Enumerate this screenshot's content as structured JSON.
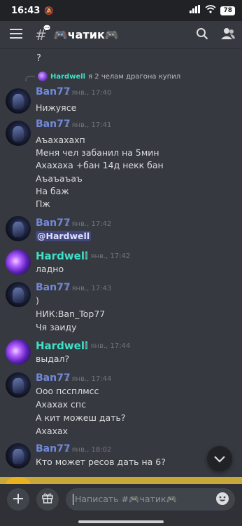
{
  "status_bar": {
    "time": "16:43",
    "battery": "78"
  },
  "header": {
    "channel_title": "🎮чатик🎮"
  },
  "chat": {
    "first_line": "?",
    "reply_preview": {
      "name": "Hardwell",
      "text": "я 2 челам драгона купил"
    },
    "messages": [
      {
        "author": "Ban77",
        "timestamp": "1 янв., 17:40",
        "lines": [
          "Нижуясе"
        ]
      },
      {
        "author": "Ban77",
        "timestamp": "1 янв., 17:41",
        "lines": [
          "Аъахахахп",
          "Меня чел забанил на 5мин",
          "Ахахаха +бан 14д некк бан",
          "Аъаъаъаъ",
          "На баж",
          "Пж"
        ]
      },
      {
        "author": "Ban77",
        "timestamp": "1 янв., 17:42",
        "lines": [
          "@Hardwell"
        ]
      },
      {
        "author": "Hardwell",
        "timestamp": "1 янв., 17:42",
        "lines": [
          "ладно"
        ]
      },
      {
        "author": "Ban77",
        "timestamp": "1 янв., 17:43",
        "lines": [
          ")",
          "НИК:Ban_Top77",
          "Чя заиду"
        ]
      },
      {
        "author": "Hardwell",
        "timestamp": "1 янв., 17:44",
        "lines": [
          "выдал?"
        ]
      },
      {
        "author": "Ban77",
        "timestamp": "1 янв., 17:44",
        "lines": [
          "Ооо пссплмсс",
          "Ахахах спс",
          "А кит можеш дать?",
          "Ахахах"
        ]
      },
      {
        "author": "Ban77",
        "timestamp": "1 янв., 18:02",
        "lines": [
          "Кто может ресов дать на 6?"
        ]
      }
    ]
  },
  "composer": {
    "placeholder": "Написать #🎮чатик🎮"
  },
  "colors": {
    "background": "#36393f",
    "ban_name": "#7289da",
    "hardwell_name": "#3ee0c8",
    "mention_bg": "#5865f2"
  },
  "icons": [
    "menu-icon",
    "channel-hash-icon",
    "search-icon",
    "members-icon",
    "chevron-down-icon",
    "plus-icon",
    "gift-icon",
    "emoji-icon"
  ]
}
